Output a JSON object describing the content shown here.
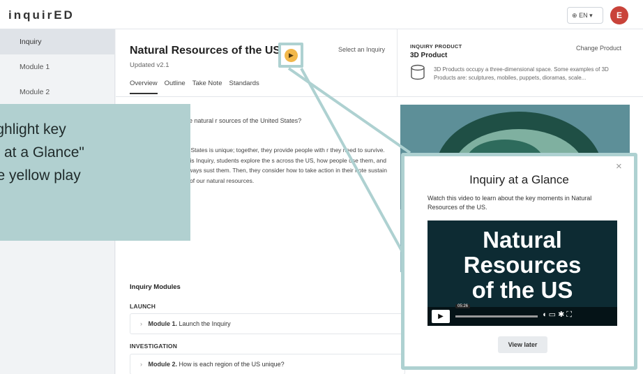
{
  "header": {
    "logo": "inquirED",
    "language": "EN",
    "avatar_initial": "E"
  },
  "sidebar": {
    "items": [
      {
        "label": "Inquiry",
        "active": true
      },
      {
        "label": "Module 1"
      },
      {
        "label": "Module 2"
      }
    ]
  },
  "inquiry": {
    "title": "Natural Resources of the US",
    "updated": "Updated v2.1",
    "select_label": "Select an Inquiry",
    "play_glyph": "▶",
    "tabs": [
      "Overview",
      "Outline",
      "Take Note",
      "Standards"
    ],
    "question": "e the natural r sources of the United States?",
    "paragraph": "Unit States is unique; together, they provide people with r they need to survive. In this Inquiry, students explore the s across the US, how people use them, and the ways sust them. Then, they consider how to take action in their note sustain use of our natural resources."
  },
  "product": {
    "eyebrow": "INQUIRY PRODUCT",
    "title": "3D Product",
    "change_label": "Change Product",
    "description": "3D Products occupy a three-dimensional space. Some examples of 3D Products are: sculptures, mobiles, puppets, dioramas, scale..."
  },
  "modules": {
    "heading": "Inquiry Modules",
    "groups": [
      {
        "name": "LAUNCH",
        "module_num": "Module 1.",
        "module_text": "Launch the Inquiry"
      },
      {
        "name": "INVESTIGATION",
        "module_num": "Module 2.",
        "module_text": "How is each region of the US unique?"
      }
    ]
  },
  "callout": {
    "lines": [
      "highlight key",
      "iry at a Glance\"",
      "the yellow play"
    ]
  },
  "popup": {
    "title": "Inquiry at a Glance",
    "description": "Watch this video to learn about the key moments in Natural Resources of the US.",
    "video_title": [
      "Natural",
      "Resources",
      "of the US"
    ],
    "video_time": "05:26",
    "view_later": "View later",
    "close_glyph": "×"
  },
  "colors": {
    "accent_teal": "#aed1d1",
    "play_yellow": "#f2b84b",
    "avatar_red": "#c9433a"
  }
}
